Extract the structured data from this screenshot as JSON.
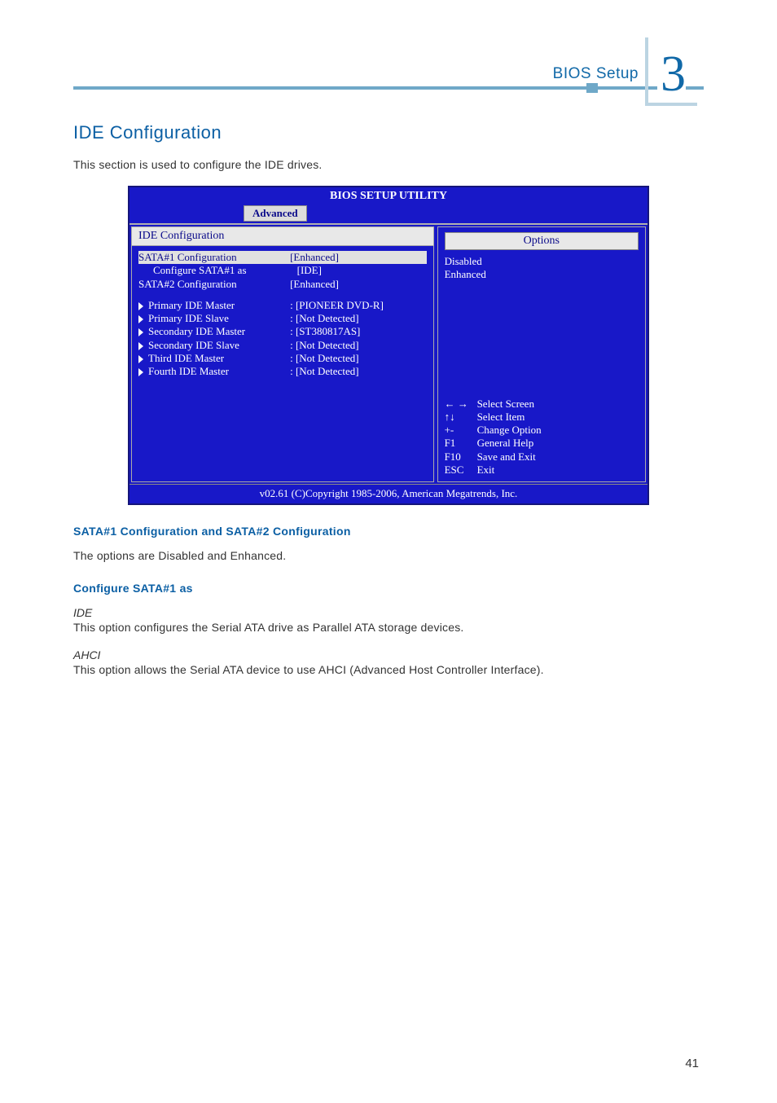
{
  "header": {
    "section_label": "BIOS Setup",
    "chapter_number": "3"
  },
  "title": "IDE Configuration",
  "intro": "This section is used to configure the IDE drives.",
  "bios": {
    "window_title": "BIOS SETUP UTILITY",
    "active_tab": "Advanced",
    "panel_heading": "IDE Configuration",
    "rows_top": [
      {
        "label": "SATA#1 Configuration",
        "value": "[Enhanced]",
        "highlight": true
      },
      {
        "label": "Configure SATA#1 as",
        "value": "[IDE]",
        "indent": true
      },
      {
        "label": "SATA#2 Configuration",
        "value": "[Enhanced]"
      }
    ],
    "rows_devices": [
      {
        "label": "Primary IDE Master",
        "value": ": [PIONEER DVD-R]"
      },
      {
        "label": "Primary IDE Slave",
        "value": ": [Not Detected]"
      },
      {
        "label": "Secondary IDE Master",
        "value": ": [ST380817AS]"
      },
      {
        "label": "Secondary IDE Slave",
        "value": ": [Not Detected]"
      },
      {
        "label": "Third IDE Master",
        "value": ": [Not Detected]"
      },
      {
        "label": "Fourth IDE Master",
        "value": ": [Not Detected]"
      }
    ],
    "options_box_title": "Options",
    "options": [
      "Disabled",
      "Enhanced"
    ],
    "legend": [
      {
        "key": "← →",
        "desc": "Select Screen"
      },
      {
        "key": "↑↓",
        "desc": "Select Item"
      },
      {
        "key": "+-",
        "desc": "Change Option"
      },
      {
        "key": "F1",
        "desc": "General Help"
      },
      {
        "key": "F10",
        "desc": "Save and Exit"
      },
      {
        "key": "ESC",
        "desc": "Exit"
      }
    ],
    "footer": "v02.61 (C)Copyright 1985-2006, American Megatrends, Inc."
  },
  "sections": {
    "sata_heading": "SATA#1 Configuration and SATA#2 Configuration",
    "sata_body": "The options are Disabled and Enhanced.",
    "cfg_heading": "Configure SATA#1 as",
    "ide_label": "IDE",
    "ide_body": "This option configures the Serial ATA drive as Parallel ATA storage devices.",
    "ahci_label": "AHCI",
    "ahci_body": "This option allows the Serial ATA device to use AHCI (Advanced Host Controller Interface)."
  },
  "page_number": "41"
}
